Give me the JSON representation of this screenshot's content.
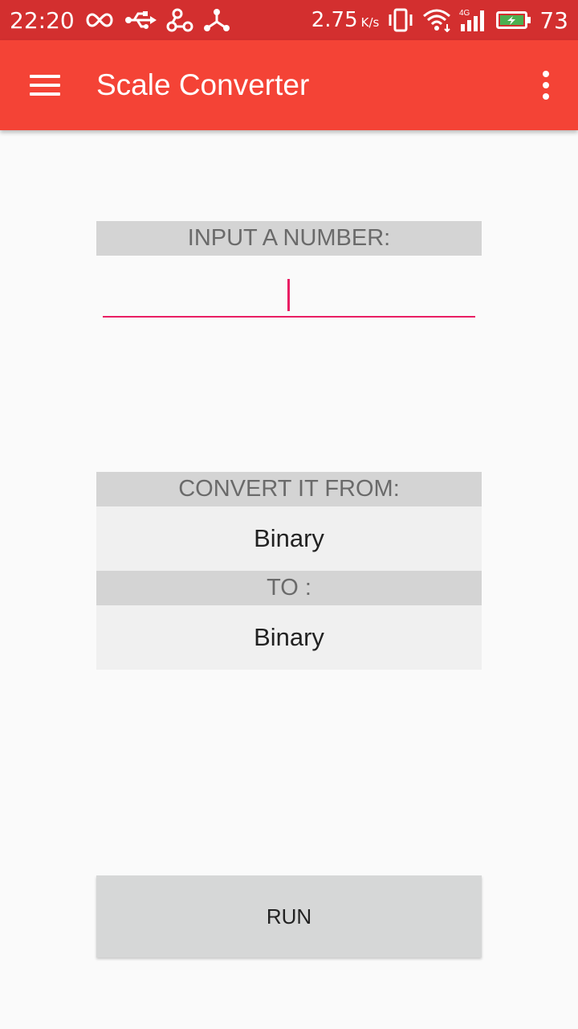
{
  "status_bar": {
    "time": "22:20",
    "speed": "2.75",
    "speed_unit": "K/s",
    "battery_level": "73",
    "icons": [
      "infinity-icon",
      "usb-icon",
      "share-node-icon",
      "tri-node-icon",
      "vibrate-icon",
      "wifi-icon",
      "signal-4g-icon",
      "battery-charging-icon"
    ]
  },
  "app_bar": {
    "title": "Scale Converter",
    "menu_icon": "hamburger-menu-icon",
    "overflow_icon": "more-vert-icon"
  },
  "input_section": {
    "label": "INPUT A NUMBER:",
    "value": "",
    "placeholder": ""
  },
  "convert_section": {
    "from_label": "CONVERT IT FROM:",
    "from_value": "Binary",
    "to_label": "TO :",
    "to_value": "Binary"
  },
  "run_button": {
    "label": "RUN"
  },
  "colors": {
    "status_bar": "#d32f2f",
    "app_bar": "#f44336",
    "accent": "#e91e63",
    "label_bg": "#d4d4d4",
    "select_bg": "#f0f0f0",
    "button_bg": "#d6d7d7"
  }
}
